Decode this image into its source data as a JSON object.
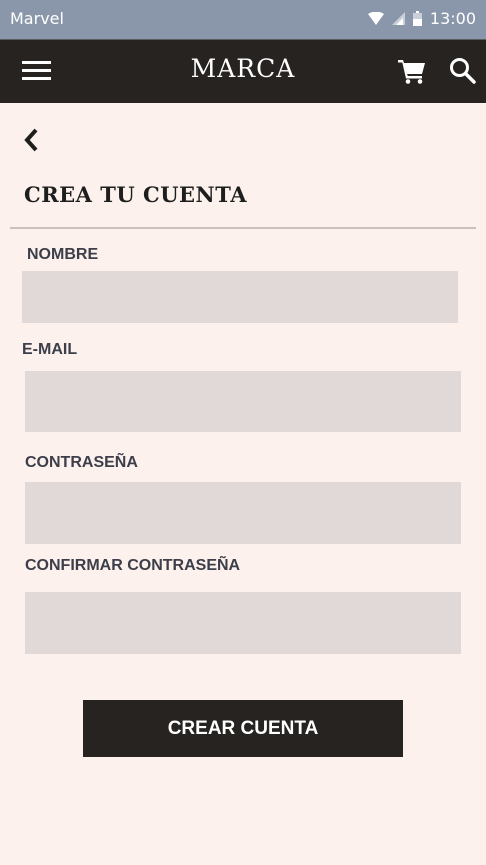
{
  "status_bar": {
    "app_name": "Marvel",
    "time": "13:00"
  },
  "app_bar": {
    "brand": "MARCA",
    "icons": [
      "menu-icon",
      "cart-icon",
      "search-icon"
    ]
  },
  "page": {
    "back_icon": "chevron-left-icon",
    "title": "CREA TU CUENTA"
  },
  "form": {
    "name_label": "NOMBRE",
    "email_label": "E-MAIL",
    "password_label": "CONTRASEÑA",
    "confirm_password_label": "CONFIRMAR CONTRASEÑA",
    "name_value": "",
    "email_value": "",
    "password_value": "",
    "confirm_password_value": "",
    "submit_label": "CREAR CUENTA"
  },
  "colors": {
    "background": "#fcf1ec",
    "status_bar": "#8a97aa",
    "app_bar": "#262321",
    "input": "#e1d9d7",
    "label": "#3c3e49",
    "button": "#262321"
  }
}
